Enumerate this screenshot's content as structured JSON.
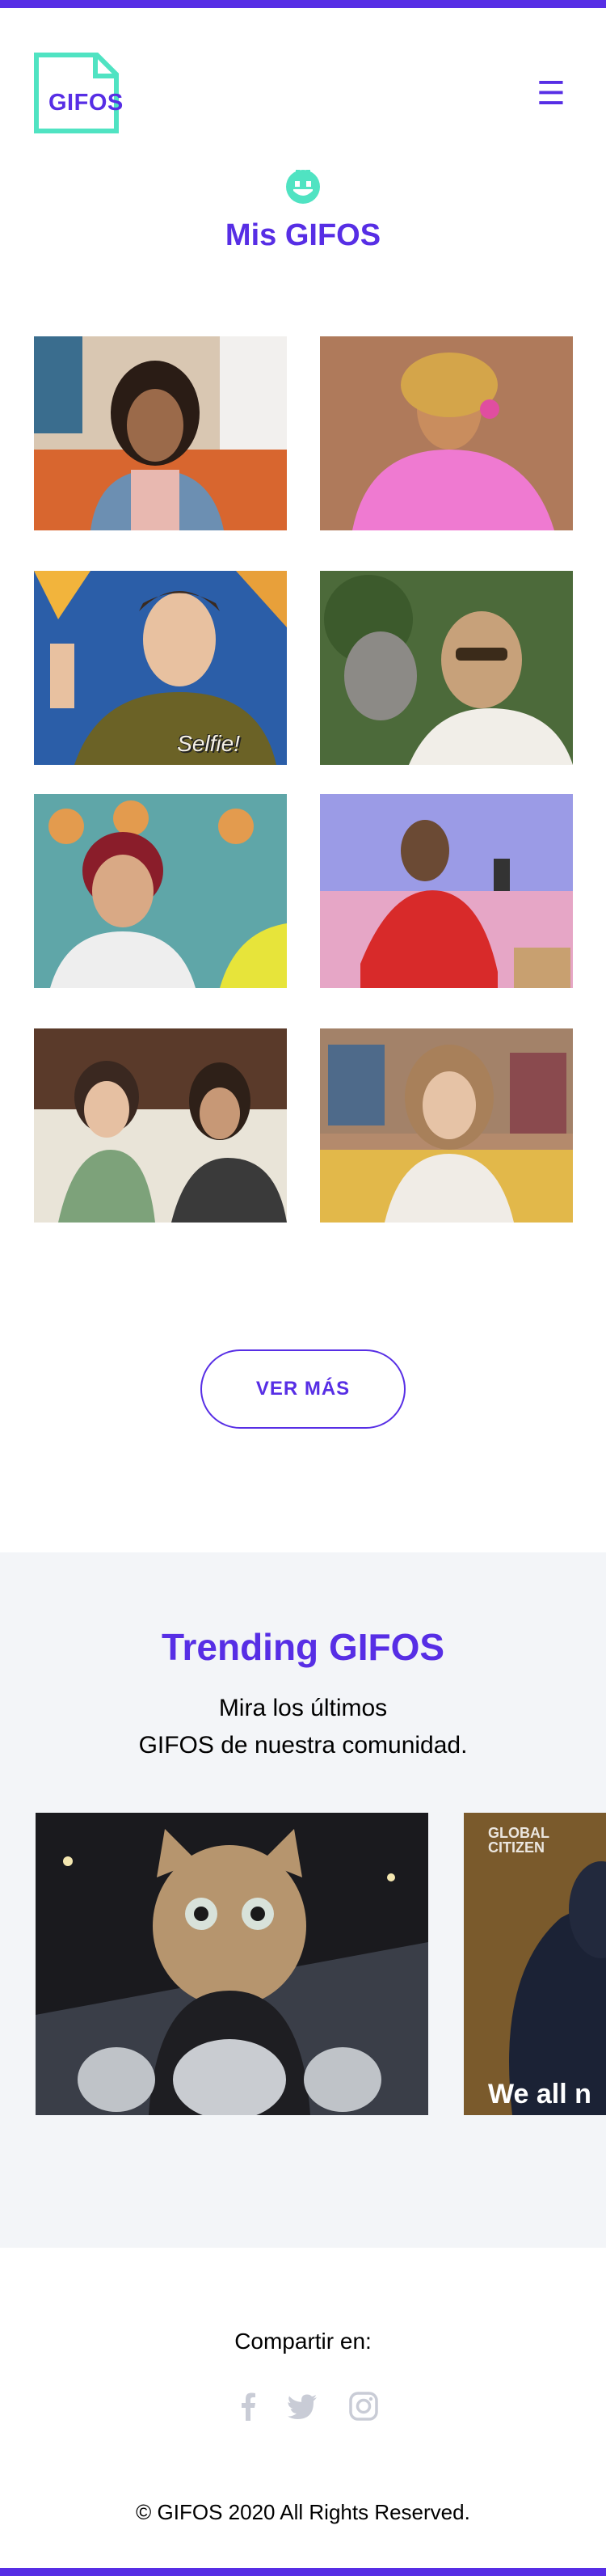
{
  "header": {
    "logo_text": "GIFOS",
    "menu_icon": "hamburger-icon"
  },
  "colors": {
    "brand": "#572EE5",
    "accent": "#50E3C2",
    "trending_bg": "#F3F5F8"
  },
  "mis_gifos": {
    "icon": "smiley-icon",
    "title": "Mis GIFOS",
    "gifs": [
      {
        "name": "gif-1",
        "caption": ""
      },
      {
        "name": "gif-2",
        "caption": ""
      },
      {
        "name": "gif-3",
        "caption": "Selfie!"
      },
      {
        "name": "gif-4",
        "caption": ""
      },
      {
        "name": "gif-5",
        "caption": ""
      },
      {
        "name": "gif-6",
        "caption": ""
      },
      {
        "name": "gif-7",
        "caption": ""
      },
      {
        "name": "gif-8",
        "caption": ""
      }
    ],
    "ver_mas_label": "VER MÁS"
  },
  "trending": {
    "title": "Trending GIFOS",
    "subtitle_line1": "Mira los últimos",
    "subtitle_line2": "GIFOS de nuestra comunidad.",
    "cards": [
      {
        "name": "trending-gif-cat",
        "caption": ""
      },
      {
        "name": "trending-gif-global-citizen",
        "brand": "GLOBAL CITIZEN",
        "caption": "We all n"
      }
    ]
  },
  "footer": {
    "share_label": "Compartir en:",
    "social": [
      "facebook-icon",
      "twitter-icon",
      "instagram-icon"
    ],
    "copyright": "© GIFOS 2020 All Rights Reserved."
  }
}
